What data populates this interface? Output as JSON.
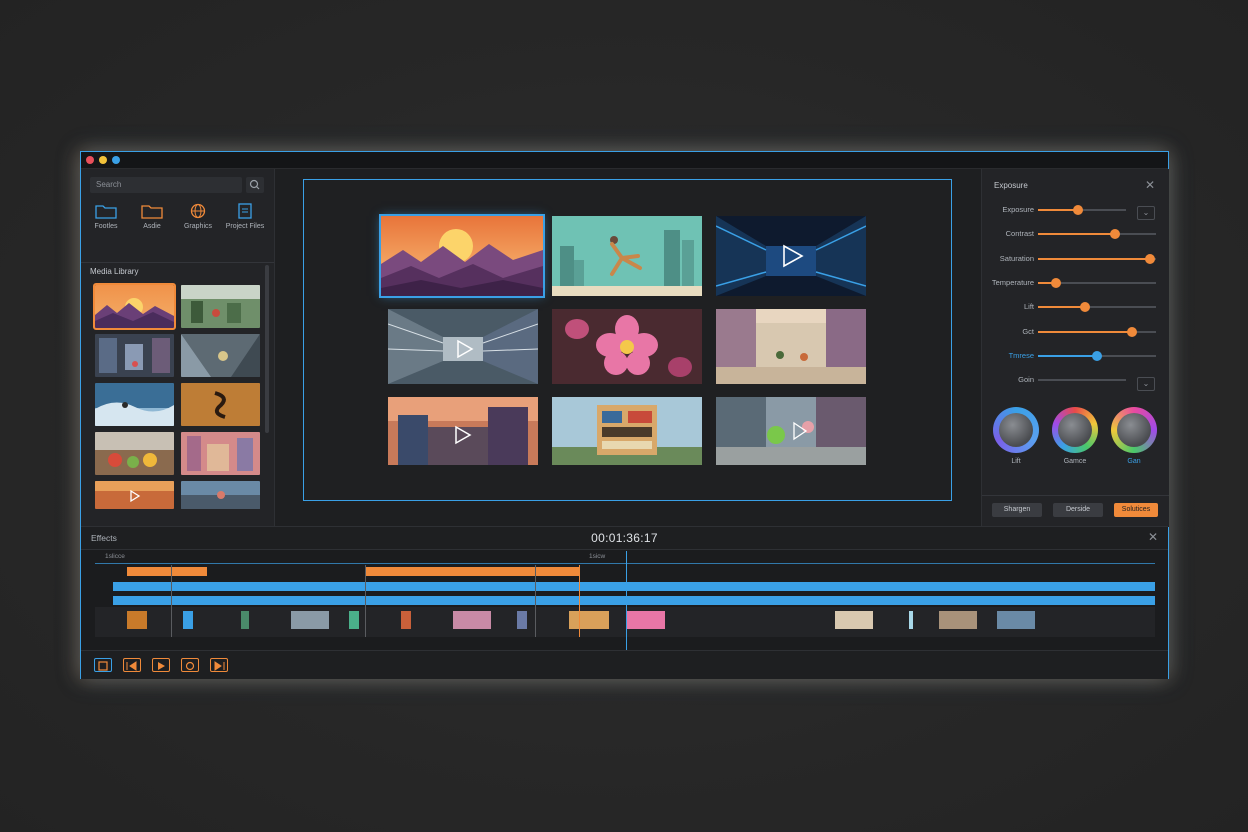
{
  "left_panel": {
    "search_placeholder": "Search",
    "categories": [
      "Footles",
      "Asdie",
      "Graphics",
      "Project Files"
    ],
    "library_title": "Media Library"
  },
  "right_panel": {
    "title": "Exposure",
    "sliders": [
      {
        "label": "Exposure",
        "value": 0.45,
        "accent": "#f08a3a"
      },
      {
        "label": "Contrast",
        "value": 0.65,
        "accent": "#f08a3a"
      },
      {
        "label": "Saturation",
        "value": 0.95,
        "accent": "#f08a3a"
      },
      {
        "label": "Temperature",
        "value": 0.15,
        "accent": "#f08a3a"
      },
      {
        "label": "Lift",
        "value": 0.4,
        "accent": "#f08a3a"
      },
      {
        "label": "Gct",
        "value": 0.8,
        "accent": "#f08a3a"
      },
      {
        "label": "Tmrese",
        "value": 0.5,
        "accent": "#3aa0e6"
      },
      {
        "label": "Goin",
        "value": 0.0,
        "accent": "#f08a3a"
      }
    ],
    "wheels": [
      "Lift",
      "Gamce",
      "Gan"
    ],
    "buttons": [
      "Shargen",
      "Derside",
      "Solutices"
    ]
  },
  "timeline": {
    "label": "Effects",
    "timecode": "00:01:36:17",
    "ruler_marks": [
      "1slicce",
      "1sicw"
    ]
  },
  "colors": {
    "accent_blue": "#3aa0e6",
    "accent_orange": "#f08a3a"
  },
  "icons": [
    "search-icon",
    "folder-icon",
    "folder-icon",
    "globe-icon",
    "file-icon",
    "close-icon",
    "chevron-down-icon",
    "play-icon"
  ]
}
